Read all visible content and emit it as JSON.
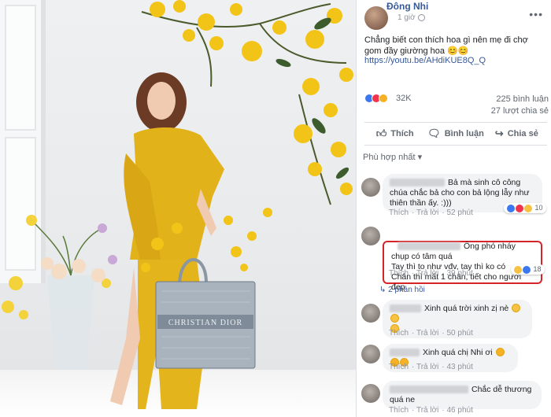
{
  "post": {
    "author": "Đông Nhi",
    "time": "1 giờ",
    "text": "Chẳng biết con thích hoa gì nên mẹ đi chợ gom đầy giường hoa 😊😊",
    "link": "https://youtu.be/AHdiKUE8Q_Q",
    "reaction_count": "32K",
    "comment_count": "225 bình luận",
    "share_count": "27 lượt chia sẻ"
  },
  "actions": {
    "like": "Thích",
    "comment": "Bình luận",
    "share": "Chia sẻ"
  },
  "sort_label": "Phù hợp nhất ▾",
  "comments": [
    {
      "text": "Bả mà sinh cô công chúa chắc bả cho con bả lộng lẫy như thiên thần ấy. :)))",
      "like": "Thích",
      "reply": "Trả lời",
      "time": "52 phút",
      "reaction_count": "10"
    },
    {
      "text": "Ông phó nháy chụp có tâm quá\nTay thì to như vđv, tay thì ko có\nChân thì mất 1 chân, tiết cho người đẹp",
      "like": "Thích",
      "reply": "Trả lời",
      "time": "39 phút",
      "reaction_count": "18",
      "replies_label": "2 phản hồi"
    },
    {
      "text": "Xinh quá trời xinh zị nè",
      "like": "Thích",
      "reply": "Trả lời",
      "time": "50 phút"
    },
    {
      "text": "Xinh quá chị Nhi ơi",
      "like": "Thích",
      "reply": "Trả lời",
      "time": "43 phút"
    },
    {
      "text": "Chắc dễ thương quá ne",
      "like": "Thích",
      "reply": "Trả lời",
      "time": "46 phút"
    }
  ],
  "photo": {
    "bag_text": "CHRISTIAN DIOR"
  },
  "colors": {
    "dress": "#e1b21a",
    "link": "#385898",
    "highlight": "#d6252a"
  }
}
